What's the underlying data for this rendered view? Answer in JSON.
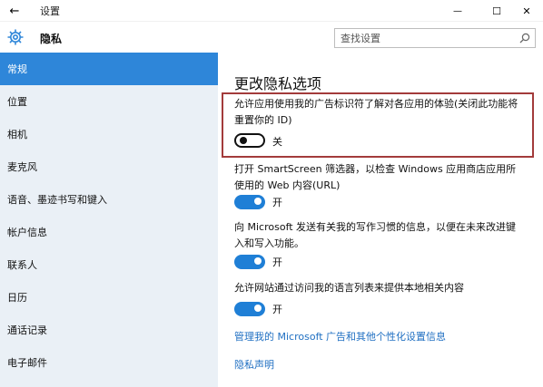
{
  "titlebar": {
    "title": "设置",
    "back_glyph": "←",
    "min_glyph": "—",
    "max_glyph": "☐",
    "close_glyph": "✕"
  },
  "header": {
    "title": "隐私",
    "search_placeholder": "查找设置"
  },
  "sidebar": {
    "items": [
      {
        "label": "常规",
        "active": true
      },
      {
        "label": "位置",
        "active": false
      },
      {
        "label": "相机",
        "active": false
      },
      {
        "label": "麦克风",
        "active": false
      },
      {
        "label": "语音、墨迹书写和键入",
        "active": false
      },
      {
        "label": "帐户信息",
        "active": false
      },
      {
        "label": "联系人",
        "active": false
      },
      {
        "label": "日历",
        "active": false
      },
      {
        "label": "通话记录",
        "active": false
      },
      {
        "label": "电子邮件",
        "active": false
      }
    ]
  },
  "main": {
    "title": "更改隐私选项",
    "options": [
      {
        "line1": "允许应用使用我的广告标识符了解对各应用的体验(关闭此功能将",
        "line2": "重置你的 ID)",
        "state": "off",
        "state_label": "关"
      },
      {
        "line1": "打开 SmartScreen 筛选器，以检查 Windows 应用商店应用所",
        "line2": "使用的 Web 内容(URL)",
        "state": "on",
        "state_label": "开"
      },
      {
        "line1": "向 Microsoft 发送有关我的写作习惯的信息，以便在未来改进键",
        "line2": "入和写入功能。",
        "state": "on",
        "state_label": "开"
      },
      {
        "line1": "允许网站通过访问我的语言列表来提供本地相关内容",
        "line2": "",
        "state": "on",
        "state_label": "开"
      }
    ],
    "links": [
      "管理我的 Microsoft 广告和其他个性化设置信息",
      "隐私声明"
    ]
  },
  "colors": {
    "accent": "#2e86d9",
    "toggle_on": "#1f7fd6",
    "link": "#1f6fc2",
    "highlight_border": "#a33b3b",
    "sidebar_bg": "#eaf0f6"
  }
}
